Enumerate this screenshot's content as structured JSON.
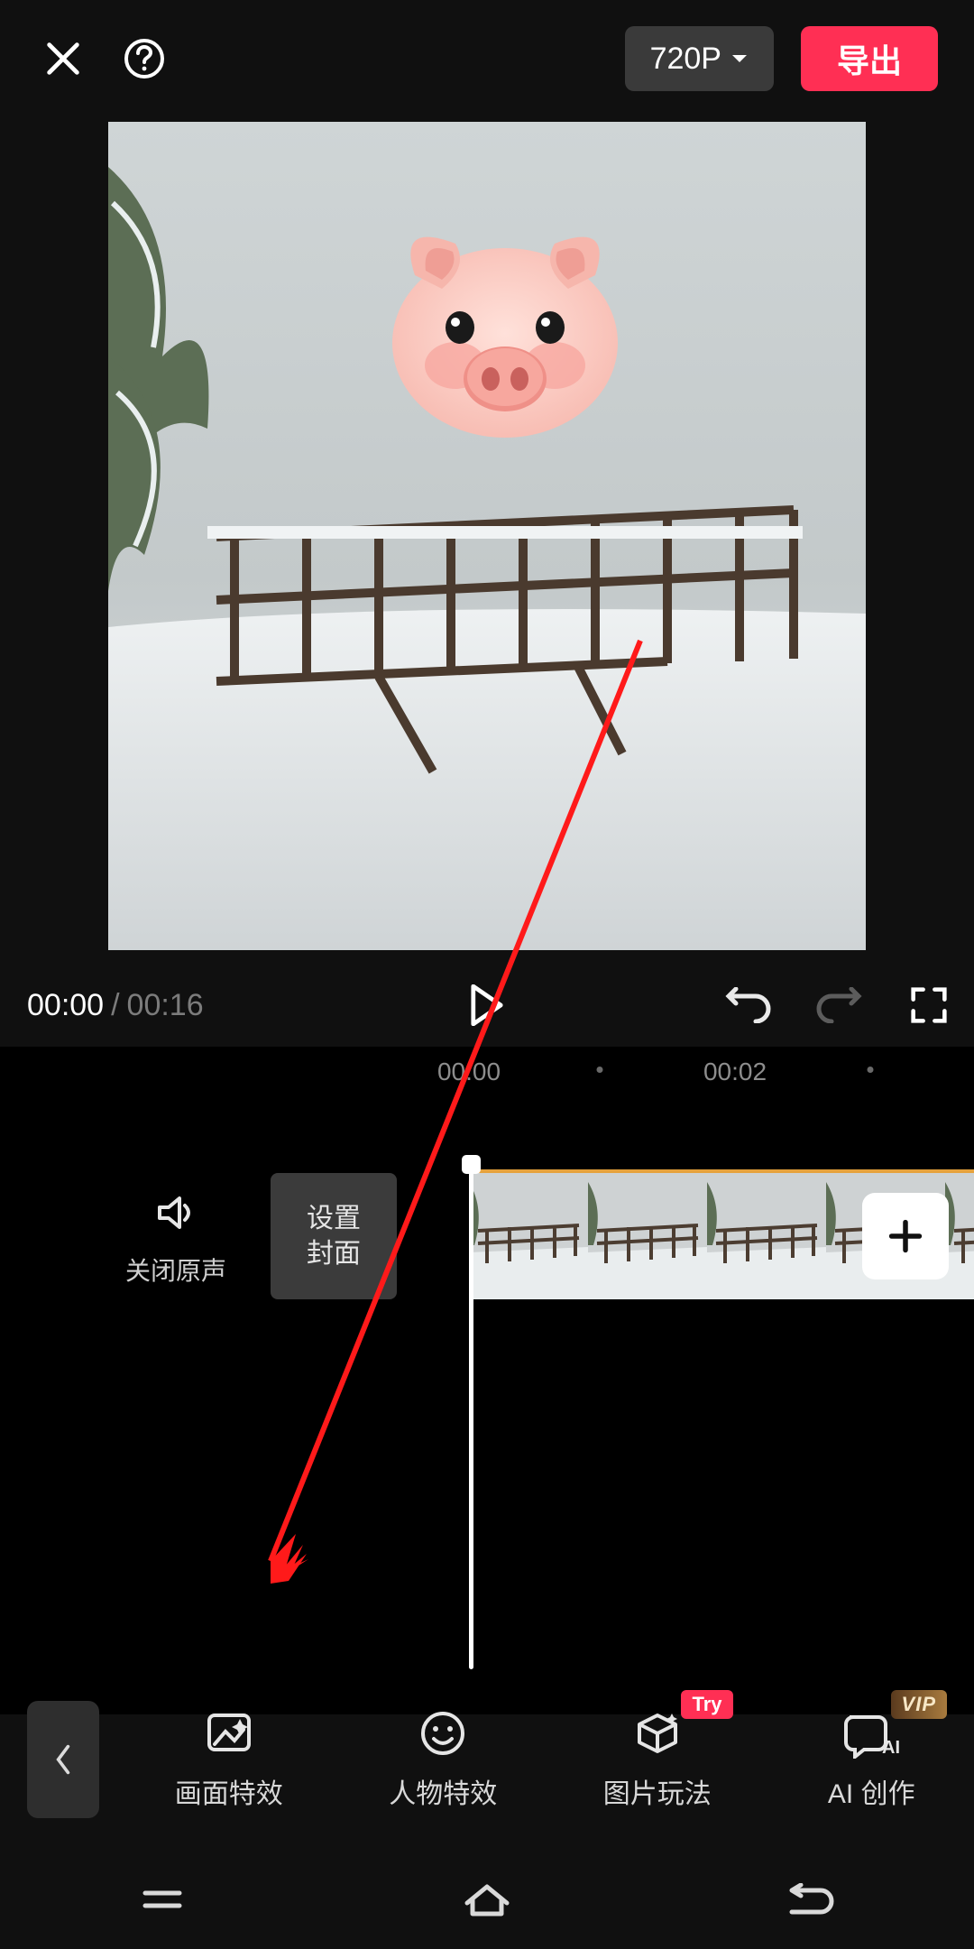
{
  "header": {
    "resolution_label": "720P",
    "export_label": "导出"
  },
  "playback": {
    "current_time": "00:00",
    "separator": "/",
    "total_time": "00:16"
  },
  "ruler": {
    "marks": [
      "00:00",
      "00:02"
    ]
  },
  "timeline": {
    "mute_label": "关闭原声",
    "cover_line1": "设置",
    "cover_line2": "封面"
  },
  "tools": [
    {
      "id": "screen-effects",
      "label": "画面特效",
      "badge": null
    },
    {
      "id": "person-effects",
      "label": "人物特效",
      "badge": null
    },
    {
      "id": "image-play",
      "label": "图片玩法",
      "badge": "Try",
      "badge_class": "badge-try"
    },
    {
      "id": "ai-create",
      "label": "AI 创作",
      "badge": "VIP",
      "badge_class": "badge-vip"
    }
  ],
  "colors": {
    "accent": "#ff2f54"
  }
}
